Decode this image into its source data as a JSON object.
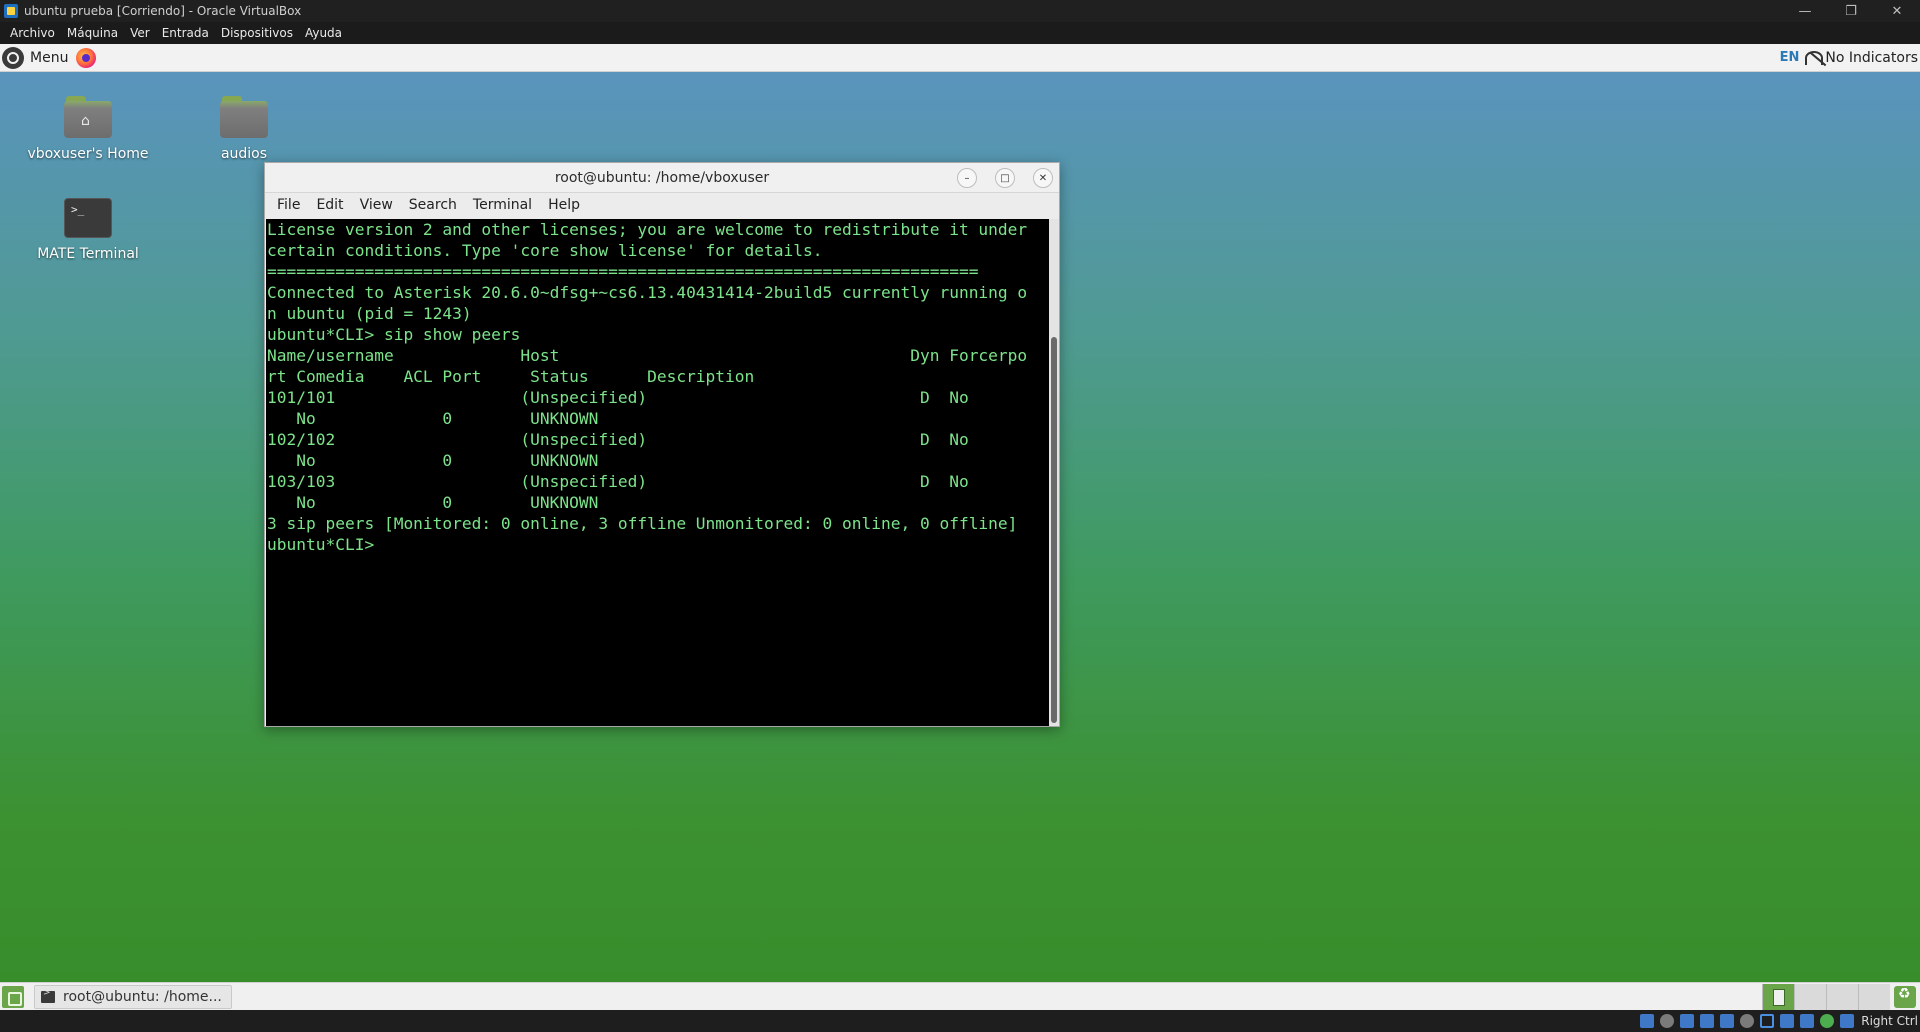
{
  "host_window": {
    "title": "ubuntu prueba [Corriendo] - Oracle VirtualBox",
    "controls": [
      "minimize",
      "restore",
      "close"
    ]
  },
  "host_menu": [
    "Archivo",
    "Máquina",
    "Ver",
    "Entrada",
    "Dispositivos",
    "Ayuda"
  ],
  "top_panel": {
    "menu_label": "Menu",
    "lang": "EN",
    "indicators": "No Indicators"
  },
  "desktop_icons": [
    {
      "label": "vboxuser's Home"
    },
    {
      "label": "audios"
    },
    {
      "label": "MATE Terminal",
      "glyph": ">_"
    }
  ],
  "terminal": {
    "title": "root@ubuntu: /home/vboxuser",
    "menu": [
      "File",
      "Edit",
      "View",
      "Search",
      "Terminal",
      "Help"
    ],
    "lines": [
      "License version 2 and other licenses; you are welcome to redistribute it under",
      "certain conditions. Type 'core show license' for details.",
      "=========================================================================",
      "Connected to Asterisk 20.6.0~dfsg+~cs6.13.40431414-2build5 currently running o",
      "n ubuntu (pid = 1243)",
      "ubuntu*CLI> sip show peers",
      "Name/username             Host                                    Dyn Forcerpo",
      "rt Comedia    ACL Port     Status      Description",
      "101/101                   (Unspecified)                            D  No",
      "   No             0        UNKNOWN",
      "102/102                   (Unspecified)                            D  No",
      "   No             0        UNKNOWN",
      "103/103                   (Unspecified)                            D  No",
      "   No             0        UNKNOWN",
      "3 sip peers [Monitored: 0 online, 3 offline Unmonitored: 0 online, 0 offline]",
      "ubuntu*CLI> "
    ]
  },
  "bottom_panel": {
    "task_label": "root@ubuntu: /home..."
  },
  "status_bar": {
    "host_key": "Right Ctrl"
  }
}
